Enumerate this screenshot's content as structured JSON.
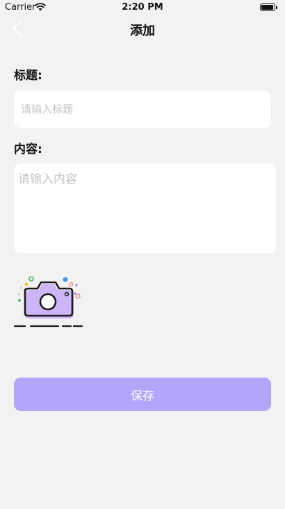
{
  "status_bar": {
    "carrier": "Carrier",
    "time": "2:20 PM",
    "icons": [
      "wifi-icon",
      "battery-icon"
    ]
  },
  "nav": {
    "back_icon": "chevron-left-icon",
    "title": "添加"
  },
  "form": {
    "title_label": "标题:",
    "title_placeholder": "请输入标题",
    "content_label": "内容:",
    "content_placeholder": "请输入内容",
    "photo_icon": "camera-icon",
    "save_label": "保存"
  },
  "colors": {
    "background": "#f2f2f2",
    "field_background": "#ffffff",
    "accent": "#b2a6fa",
    "camera_fill": "#cdb6f7"
  }
}
